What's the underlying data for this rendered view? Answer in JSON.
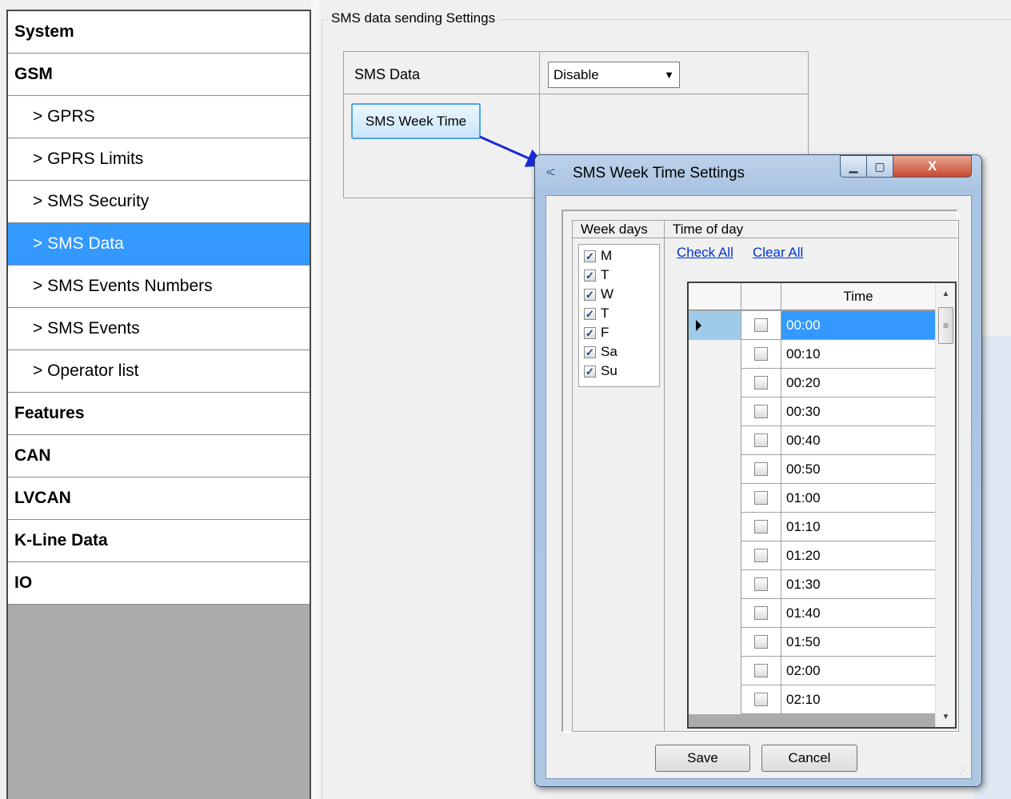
{
  "sidebar": {
    "items": [
      {
        "label": "System",
        "level": "top",
        "active": false
      },
      {
        "label": "GSM",
        "level": "top",
        "active": false
      },
      {
        "label": "> GPRS",
        "level": "sub",
        "active": false
      },
      {
        "label": "> GPRS Limits",
        "level": "sub",
        "active": false
      },
      {
        "label": "> SMS Security",
        "level": "sub",
        "active": false
      },
      {
        "label": "> SMS Data",
        "level": "sub",
        "active": true
      },
      {
        "label": "> SMS Events Numbers",
        "level": "sub",
        "active": false
      },
      {
        "label": "> SMS Events",
        "level": "sub",
        "active": false
      },
      {
        "label": "> Operator list",
        "level": "sub",
        "active": false
      },
      {
        "label": "Features",
        "level": "top",
        "active": false
      },
      {
        "label": "CAN",
        "level": "top",
        "active": false
      },
      {
        "label": "LVCAN",
        "level": "top",
        "active": false
      },
      {
        "label": "K-Line Data",
        "level": "top",
        "active": false
      },
      {
        "label": "IO",
        "level": "top",
        "active": false
      }
    ]
  },
  "main": {
    "group_title": "SMS data sending Settings",
    "sms_data_label": "SMS Data",
    "sms_data_value": "Disable",
    "week_time_button": "SMS Week Time"
  },
  "dialog": {
    "title": "SMS Week Time Settings",
    "close_glyph": "X",
    "weekdays_title": "Week days",
    "timeofday_title": "Time of day",
    "check_all": "Check All",
    "clear_all": "Clear All",
    "weekdays": [
      {
        "label": "M",
        "checked": true
      },
      {
        "label": "T",
        "checked": true
      },
      {
        "label": "W",
        "checked": true
      },
      {
        "label": "T",
        "checked": true
      },
      {
        "label": "F",
        "checked": true
      },
      {
        "label": "Sa",
        "checked": true
      },
      {
        "label": "Su",
        "checked": true
      }
    ],
    "grid": {
      "time_header": "Time",
      "rows": [
        {
          "time": "00:00",
          "checked": false,
          "selected": true
        },
        {
          "time": "00:10",
          "checked": false,
          "selected": false
        },
        {
          "time": "00:20",
          "checked": false,
          "selected": false
        },
        {
          "time": "00:30",
          "checked": false,
          "selected": false
        },
        {
          "time": "00:40",
          "checked": false,
          "selected": false
        },
        {
          "time": "00:50",
          "checked": false,
          "selected": false
        },
        {
          "time": "01:00",
          "checked": false,
          "selected": false
        },
        {
          "time": "01:10",
          "checked": false,
          "selected": false
        },
        {
          "time": "01:20",
          "checked": false,
          "selected": false
        },
        {
          "time": "01:30",
          "checked": false,
          "selected": false
        },
        {
          "time": "01:40",
          "checked": false,
          "selected": false
        },
        {
          "time": "01:50",
          "checked": false,
          "selected": false
        },
        {
          "time": "02:00",
          "checked": false,
          "selected": false
        },
        {
          "time": "02:10",
          "checked": false,
          "selected": false
        }
      ]
    },
    "save_label": "Save",
    "cancel_label": "Cancel"
  },
  "colors": {
    "selection": "#3399ff",
    "link": "#0033cc",
    "arrow": "#1a2bd6"
  }
}
